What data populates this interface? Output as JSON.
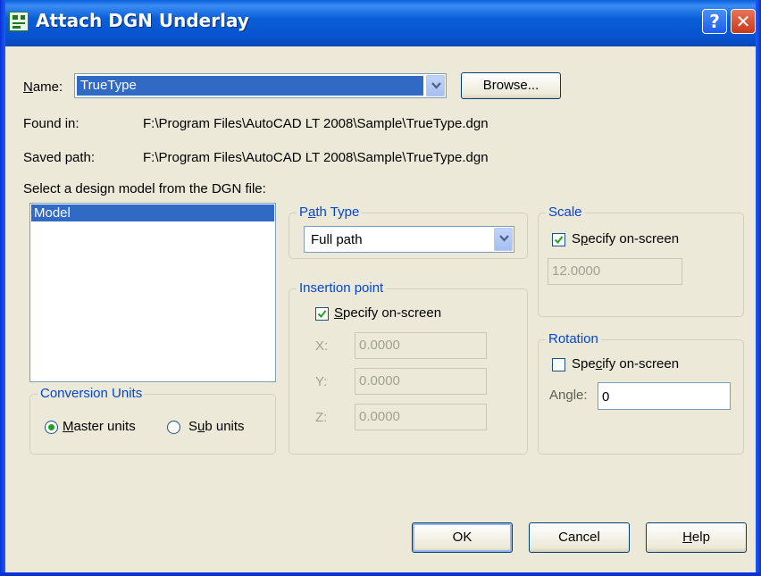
{
  "window": {
    "title": "Attach DGN Underlay",
    "help_glyph": "?",
    "close_glyph": "✕"
  },
  "name": {
    "label": "Name:",
    "value": "TrueType",
    "browse_label": "Browse..."
  },
  "found_in": {
    "label": "Found in:",
    "value": "F:\\Program Files\\AutoCAD LT 2008\\Sample\\TrueType.dgn"
  },
  "saved_path": {
    "label": "Saved path:",
    "value": "F:\\Program Files\\AutoCAD LT 2008\\Sample\\TrueType.dgn"
  },
  "model_select": {
    "label": "Select a design model from the DGN file:",
    "items": [
      "Model"
    ]
  },
  "conversion_units": {
    "title": "Conversion Units",
    "master_label": "Master units",
    "sub_label": "Sub units",
    "selected": "master"
  },
  "path_type": {
    "title": "Path Type",
    "value": "Full path"
  },
  "insertion_point": {
    "title": "Insertion point",
    "specify_label": "Specify on-screen",
    "specify_checked": true,
    "x_label": "X:",
    "x_value": "0.0000",
    "y_label": "Y:",
    "y_value": "0.0000",
    "z_label": "Z:",
    "z_value": "0.0000"
  },
  "scale": {
    "title": "Scale",
    "specify_label": "Specify on-screen",
    "specify_checked": true,
    "value": "12.0000"
  },
  "rotation": {
    "title": "Rotation",
    "specify_label": "Specify on-screen",
    "specify_checked": false,
    "angle_label": "Angle:",
    "angle_value": "0"
  },
  "buttons": {
    "ok": "OK",
    "cancel": "Cancel",
    "help": "Help"
  },
  "colors": {
    "title_bar": "#0a5fd8",
    "group_title": "#0046d5",
    "selection": "#316ac5",
    "dialog_bg": "#ece9d8"
  }
}
